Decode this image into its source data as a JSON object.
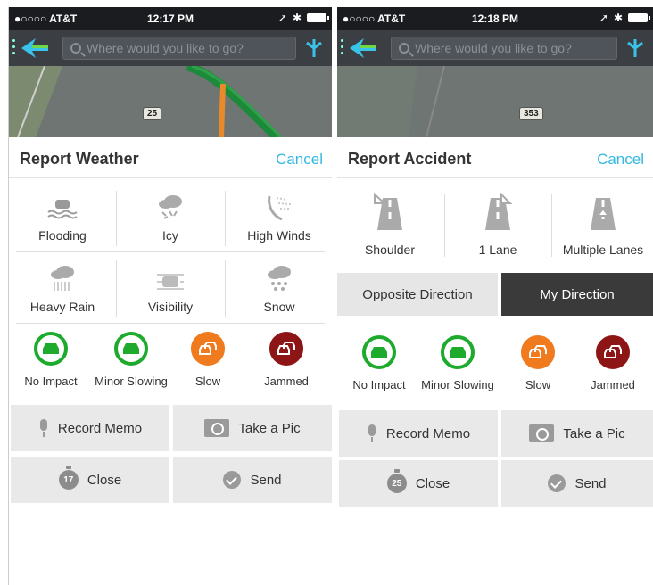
{
  "left": {
    "status": {
      "carrier": "●○○○○ AT&T",
      "time": "12:17 PM"
    },
    "search_placeholder": "Where would you like to go?",
    "map_badges": [
      "25"
    ],
    "title": "Report Weather",
    "cancel": "Cancel",
    "weather": [
      {
        "icon": "flooding-icon",
        "label": "Flooding"
      },
      {
        "icon": "icy-icon",
        "label": "Icy"
      },
      {
        "icon": "high-winds-icon",
        "label": "High Winds"
      },
      {
        "icon": "heavy-rain-icon",
        "label": "Heavy Rain"
      },
      {
        "icon": "visibility-icon",
        "label": "Visibility"
      },
      {
        "icon": "snow-icon",
        "label": "Snow"
      }
    ],
    "impact": [
      {
        "label": "No Impact",
        "color": "#1eaa2c"
      },
      {
        "label": "Minor Slowing",
        "color": "#1eaa2c"
      },
      {
        "label": "Slow",
        "color": "#f07a1e"
      },
      {
        "label": "Jammed",
        "color": "#8e1515"
      }
    ],
    "actions": {
      "record_memo": "Record Memo",
      "take_pic": "Take a Pic",
      "close": "Close",
      "close_timer": "17",
      "send": "Send"
    }
  },
  "right": {
    "status": {
      "carrier": "●○○○○ AT&T",
      "time": "12:18 PM"
    },
    "search_placeholder": "Where would you like to go?",
    "map_badges": [
      "353"
    ],
    "title": "Report Accident",
    "cancel": "Cancel",
    "lanes": [
      {
        "icon": "shoulder-icon",
        "label": "Shoulder"
      },
      {
        "icon": "one-lane-icon",
        "label": "1 Lane"
      },
      {
        "icon": "multiple-lanes-icon",
        "label": "Multiple Lanes"
      }
    ],
    "directions": {
      "opposite": "Opposite Direction",
      "mine": "My Direction",
      "selected": "My Direction"
    },
    "impact": [
      {
        "label": "No Impact",
        "color": "#1eaa2c"
      },
      {
        "label": "Minor Slowing",
        "color": "#1eaa2c"
      },
      {
        "label": "Slow",
        "color": "#f07a1e"
      },
      {
        "label": "Jammed",
        "color": "#8e1515"
      }
    ],
    "actions": {
      "record_memo": "Record Memo",
      "take_pic": "Take a Pic",
      "close": "Close",
      "close_timer": "25",
      "send": "Send"
    }
  }
}
